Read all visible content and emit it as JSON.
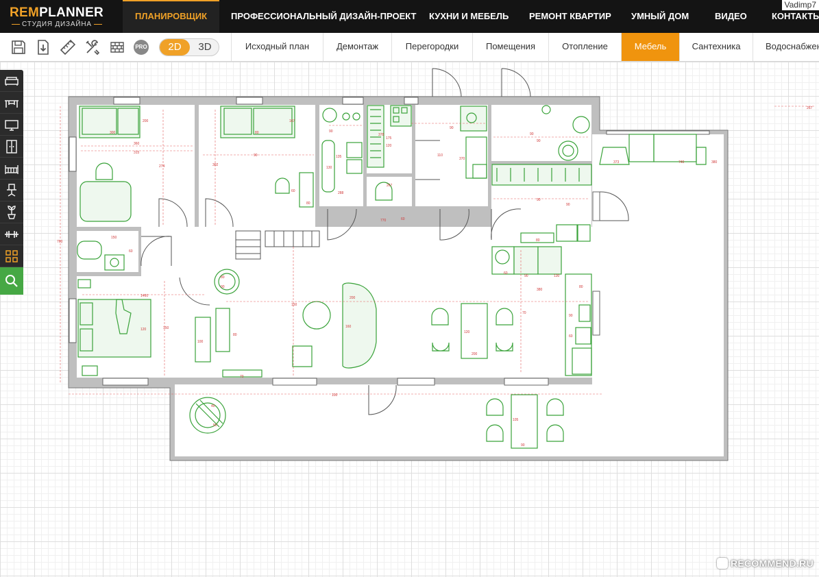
{
  "brand": {
    "logo_part1": "REM",
    "logo_part2": "PLANNER",
    "subtitle": "СТУДИЯ ДИЗАЙНА"
  },
  "topnav": [
    {
      "label": "ПЛАНИРОВЩИК",
      "active": true
    },
    {
      "label": "ПРОФЕССИОНАЛЬНЫЙ ДИЗАЙН-ПРОЕКТ"
    },
    {
      "label": "КУХНИ И МЕБЕЛЬ"
    },
    {
      "label": "РЕМОНТ КВАРТИР"
    },
    {
      "label": "УМНЫЙ ДОМ"
    },
    {
      "label": "ВИДЕО"
    },
    {
      "label": "КОНТАКТЫ"
    }
  ],
  "username": "Vadimp7",
  "toolbar": {
    "tools": [
      "save-icon",
      "import-icon",
      "ruler-icon",
      "tools-icon",
      "bricks-icon"
    ],
    "pro_label": "PRO",
    "view_2d": "2D",
    "view_3d": "3D",
    "view_active": "2D"
  },
  "stage_tabs": [
    {
      "label": "Исходный план"
    },
    {
      "label": "Демонтаж"
    },
    {
      "label": "Перегородки"
    },
    {
      "label": "Помещения"
    },
    {
      "label": "Отопление"
    },
    {
      "label": "Мебель",
      "active": true
    },
    {
      "label": "Сантехника"
    },
    {
      "label": "Водоснабжение"
    }
  ],
  "sidepanel": [
    "sofa-icon",
    "table-icon",
    "tv-icon",
    "wardrobe-icon",
    "crib-icon",
    "office-chair-icon",
    "plant-icon",
    "dumbbell-icon",
    "grid-icon",
    "search-icon"
  ],
  "plan_labels": {
    "dims": [
      "300",
      "360",
      "315",
      "274",
      "302",
      "90",
      "200",
      "80",
      "167",
      "175",
      "378",
      "135",
      "90",
      "120",
      "130",
      "370",
      "110",
      "288",
      "267",
      "90",
      "90",
      "90",
      "90",
      "90",
      "373",
      "740",
      "380",
      "380",
      "200",
      "150",
      "70",
      "160",
      "120",
      "200",
      "120",
      "100",
      "1460",
      "150",
      "70",
      "100",
      "105",
      "90",
      "40",
      "50",
      "60",
      "80",
      "90",
      "80",
      "60",
      "80",
      "770",
      "80",
      "60",
      "90",
      "130",
      "150",
      "60",
      "80",
      "90",
      "60",
      "267",
      "760"
    ]
  },
  "watermark": "RECOMMEND.RU",
  "colors": {
    "accent": "#f0a127",
    "tab_active": "#f0940e",
    "furniture": "#3aa53a",
    "wall": "#9a9a9a"
  }
}
